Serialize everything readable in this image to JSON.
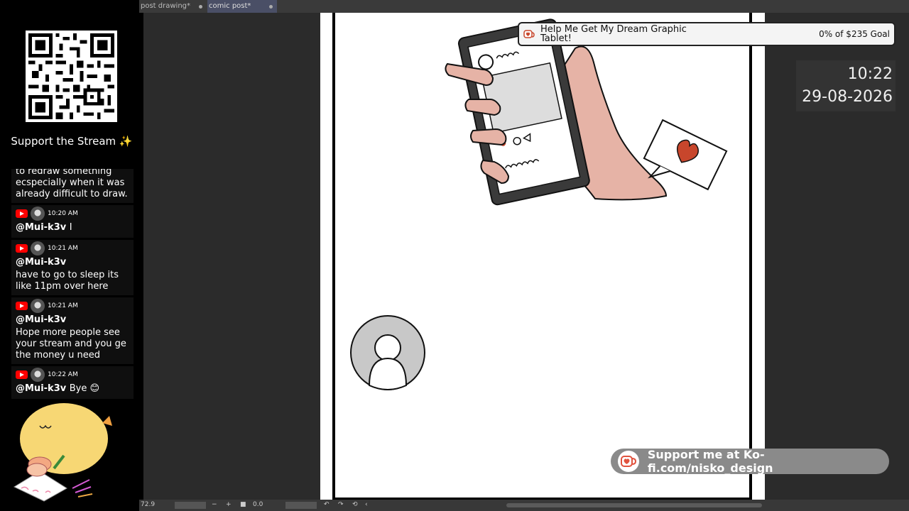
{
  "tabs": [
    {
      "label": "post drawing*",
      "active": false
    },
    {
      "label": "comic post*",
      "active": true
    }
  ],
  "sidebar": {
    "support_title": "Support the Stream ✨",
    "chat": [
      {
        "partial_text": "to redraw something ecspecially when it was already difficult to draw."
      },
      {
        "time": "10:20 AM",
        "user": "@Mui-k3v",
        "inline": "I"
      },
      {
        "time": "10:21 AM",
        "user": "@Mui-k3v",
        "text": "have to go to sleep its like 11pm over here"
      },
      {
        "time": "10:21 AM",
        "user": "@Mui-k3v",
        "text": "Hope more people see your stream and you ge the money u need"
      },
      {
        "time": "10:22 AM",
        "user": "@Mui-k3v",
        "inline": "Bye 😊"
      }
    ]
  },
  "goal": {
    "title": "Help Me Get My Dream Graphic Tablet!",
    "status": "0% of $235 Goal",
    "progress": 0
  },
  "clock": {
    "time": "10:22",
    "date": "29-08-2026"
  },
  "kofi": {
    "text": "Support me at Ko-fi.com/nisko_design"
  },
  "statusbar": {
    "zoom": "72.9",
    "angle": "0.0"
  },
  "colors": {
    "accent_tab": "#4a4f66",
    "kofi_red": "#e0523e",
    "hand": "#e6b3a6",
    "heart": "#c8462c"
  }
}
